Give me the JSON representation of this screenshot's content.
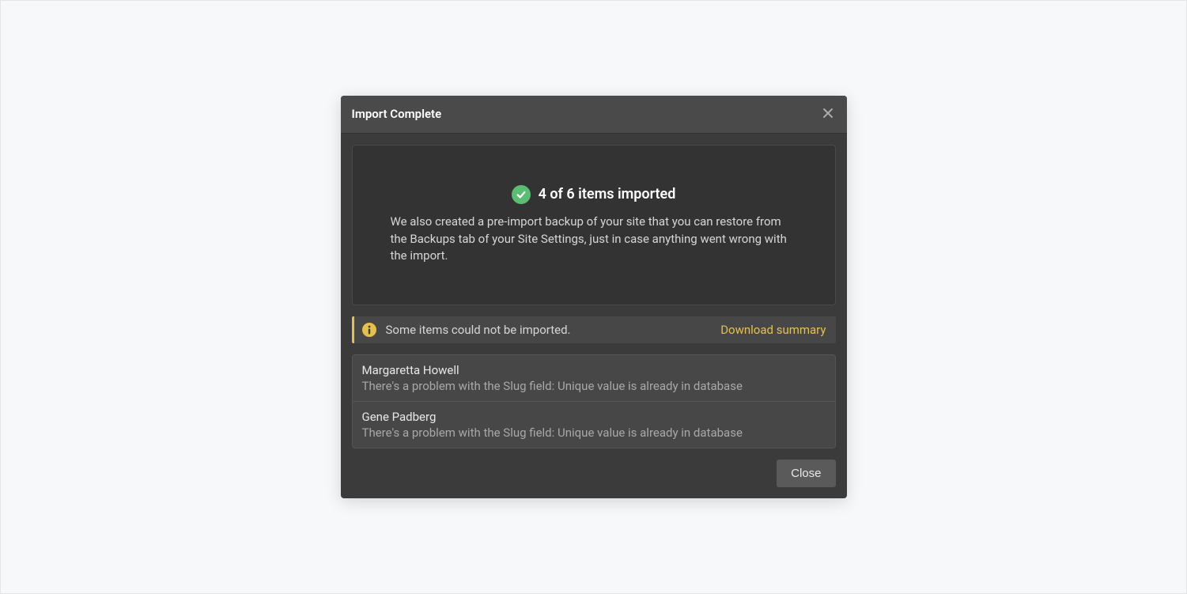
{
  "modal": {
    "title": "Import Complete",
    "summary": {
      "heading": "4 of 6 items imported",
      "description": "We also created a pre-import backup of your site that you can restore from the Backups tab of your Site Settings, just in case anything went wrong with the import."
    },
    "warning": {
      "text": "Some items could not be imported.",
      "link_label": "Download summary"
    },
    "errors": [
      {
        "name": "Margaretta Howell",
        "detail": "There's a problem with the Slug field: Unique value is already in database"
      },
      {
        "name": "Gene Padberg",
        "detail": "There's a problem with the Slug field: Unique value is already in database"
      }
    ],
    "close_label": "Close"
  }
}
